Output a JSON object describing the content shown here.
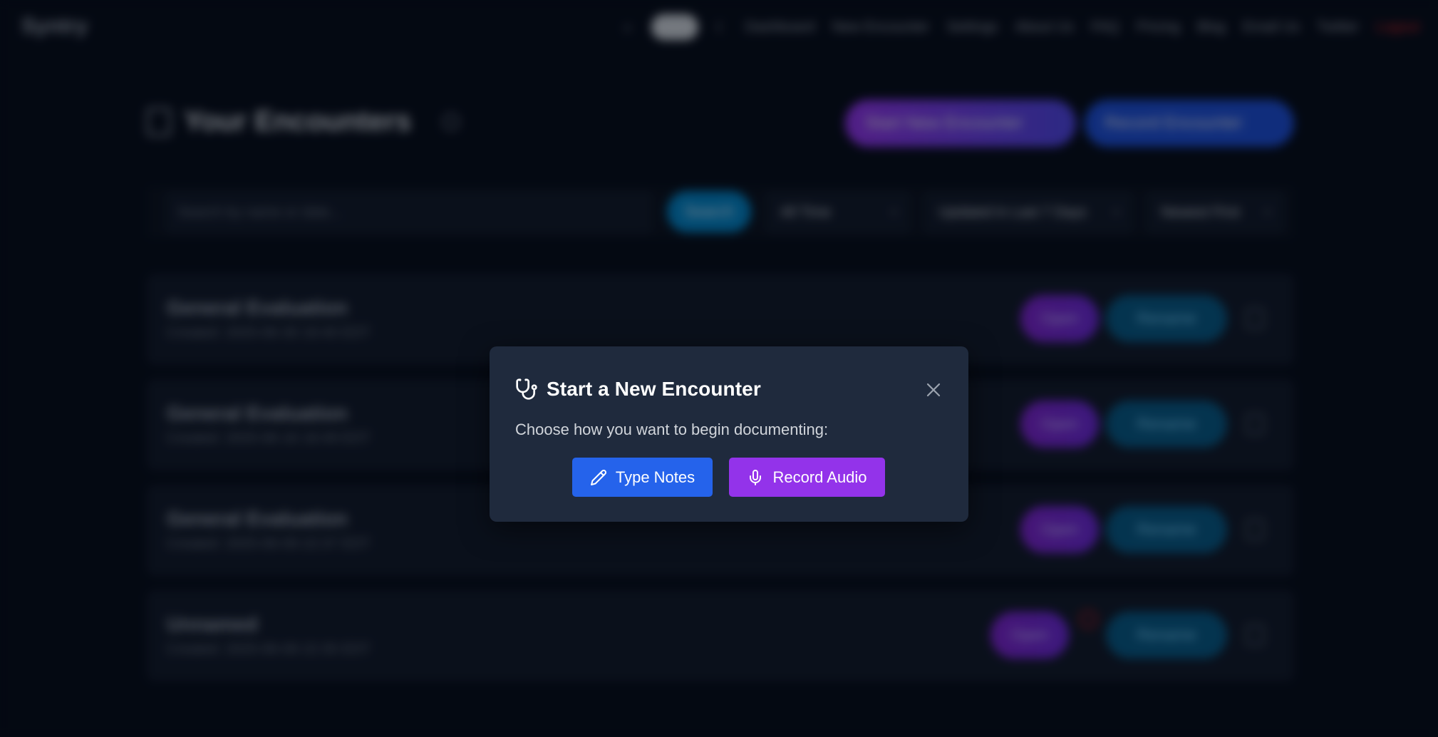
{
  "background": {
    "brand": "Syntry",
    "nav": {
      "sun_glyph": "☼",
      "moon_glyph": "☾",
      "items": [
        "Dashboard",
        "New Encounter",
        "Settings",
        "About Us",
        "FAQ",
        "Pricing",
        "Blog",
        "Email Us",
        "Twitter"
      ],
      "logout": "Logout"
    },
    "page_title": "Your Encounters",
    "start_button": "Start New Encounter",
    "record_button": "Record Encounter",
    "filters": {
      "search_placeholder": "Search by name or date...",
      "search_button": "Search",
      "time_select": "All Time",
      "updated_select": "Updated in Last 7 Days",
      "sort_select": "Newest First"
    },
    "encounters": [
      {
        "title": "General Evaluation",
        "date": "Created: 2025-06-30 16:40 EDT",
        "open": "Open",
        "rename": "Rename"
      },
      {
        "title": "General Evaluation",
        "date": "Created: 2025-06-16 16:49 EDT",
        "open": "Open",
        "rename": "Rename"
      },
      {
        "title": "General Evaluation",
        "date": "Created: 2025-06-09 22:37 EDT",
        "open": "Open",
        "rename": "Rename"
      },
      {
        "title": "Unnamed",
        "date": "Created: 2025-06-09 22:35 EDT",
        "open": "Open",
        "rename": "Rename"
      }
    ]
  },
  "modal": {
    "title": "Start a New Encounter",
    "description": "Choose how you want to begin documenting:",
    "type_notes_label": "Type Notes",
    "record_audio_label": "Record Audio",
    "close_glyph": "×"
  },
  "colors": {
    "page_bg": "#060b17",
    "modal_bg": "#1f2a3d",
    "type_notes": "#2563eb",
    "record_audio": "#9333ea",
    "logout": "#dc2626"
  }
}
